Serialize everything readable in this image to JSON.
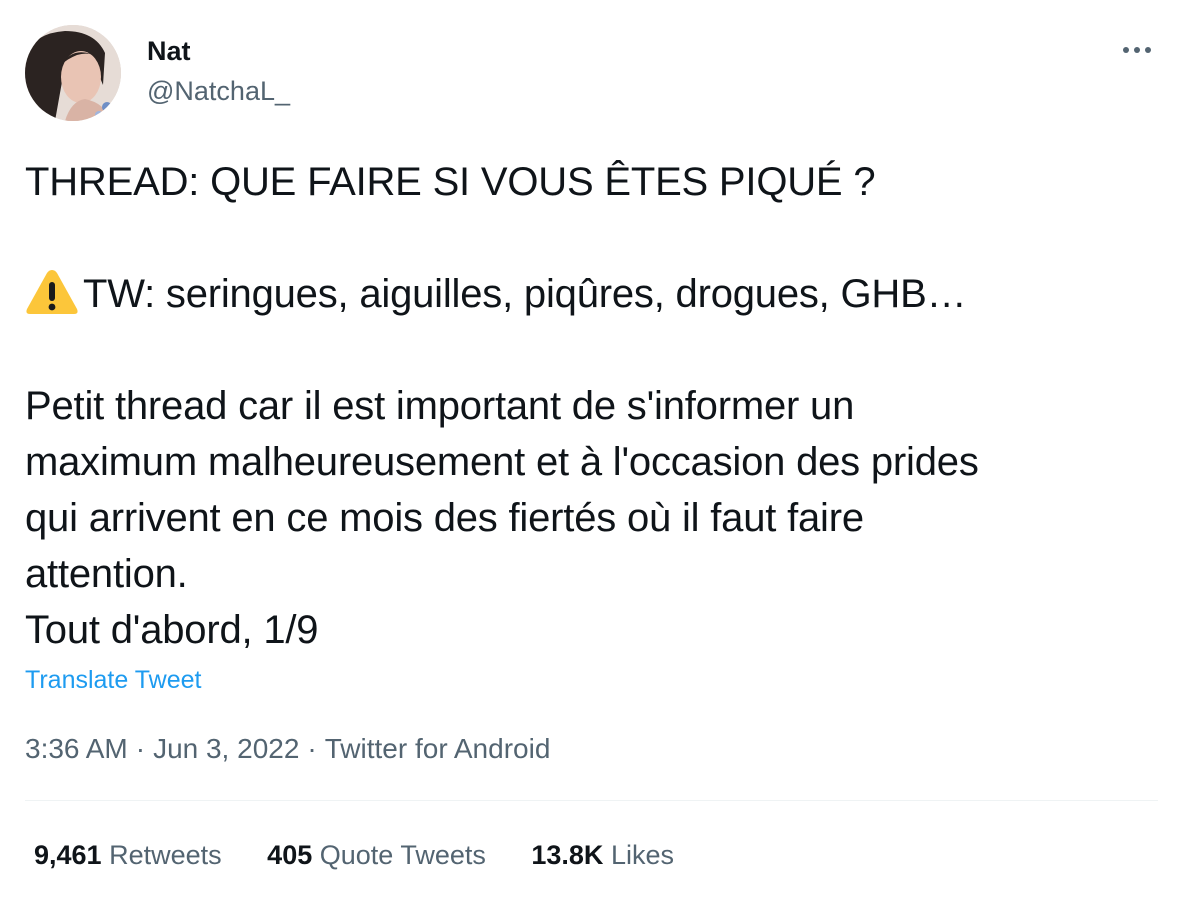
{
  "author": {
    "display_name": "Nat",
    "handle": "@NatchaL_"
  },
  "tweet": {
    "lines": [
      "THREAD: QUE FAIRE SI VOUS ÊTES PIQUÉ ?",
      "TW: seringues, aiguilles, piqûres, drogues, GHB…",
      "Petit thread car il est important de s'informer un",
      "maximum malheureusement et à l'occasion des prides",
      "qui arrivent en ce mois des fiertés où il faut faire",
      "attention.",
      "Tout d'abord, 1/9"
    ],
    "warning_icon": "warning-sign-emoji",
    "translate_label": "Translate Tweet"
  },
  "meta": {
    "time": "3:36 AM",
    "separator": "·",
    "date": "Jun 3, 2022",
    "source": "Twitter for Android"
  },
  "stats": {
    "retweets_count": "9,461",
    "retweets_label": "Retweets",
    "quotes_count": "405",
    "quotes_label": "Quote Tweets",
    "likes_count": "13.8K",
    "likes_label": "Likes"
  },
  "colors": {
    "text": "#0f1419",
    "secondary": "#536471",
    "link": "#1d9bf0",
    "divider": "#eff3f4"
  }
}
